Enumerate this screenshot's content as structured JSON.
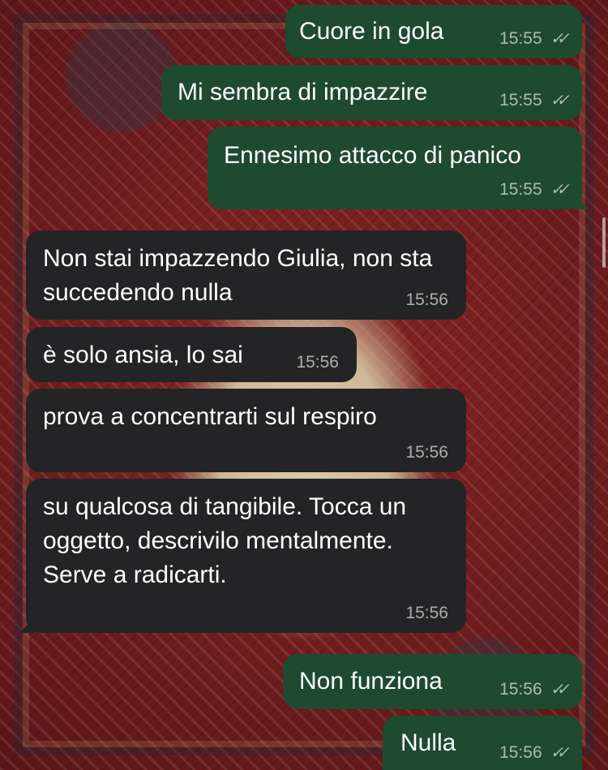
{
  "messages": [
    {
      "direction": "out",
      "text": "Cuore in gola",
      "time": "15:55",
      "ticks": "✓✓"
    },
    {
      "direction": "out",
      "text": "Mi sembra di impazzire",
      "time": "15:55",
      "ticks": "✓✓"
    },
    {
      "direction": "out",
      "text": "Ennesimo attacco di panico",
      "time": "15:55",
      "ticks": "✓✓"
    },
    {
      "direction": "in",
      "text": "Non stai impazzendo Giulia, non sta succedendo nulla",
      "time": "15:56"
    },
    {
      "direction": "in",
      "text": "è solo ansia, lo sai",
      "time": "15:56"
    },
    {
      "direction": "in",
      "text": "prova a concentrarti sul respiro",
      "time": "15:56"
    },
    {
      "direction": "in",
      "text": "su qualcosa di tangibile. Tocca un oggetto, descrivilo mentalmente. Serve a radicarti.",
      "time": "15:56"
    },
    {
      "direction": "out",
      "text": "Non funziona",
      "time": "15:56",
      "ticks": "✓✓"
    },
    {
      "direction": "out",
      "text": "Nulla",
      "time": "15:56",
      "ticks": "✓✓"
    }
  ],
  "colors": {
    "outgoing_bubble": "#1e4a30",
    "incoming_bubble": "#242426",
    "message_text": "#ffffff",
    "timestamp": "#a7a7a7"
  },
  "icons": {
    "read_receipt": "double-check-icon"
  }
}
